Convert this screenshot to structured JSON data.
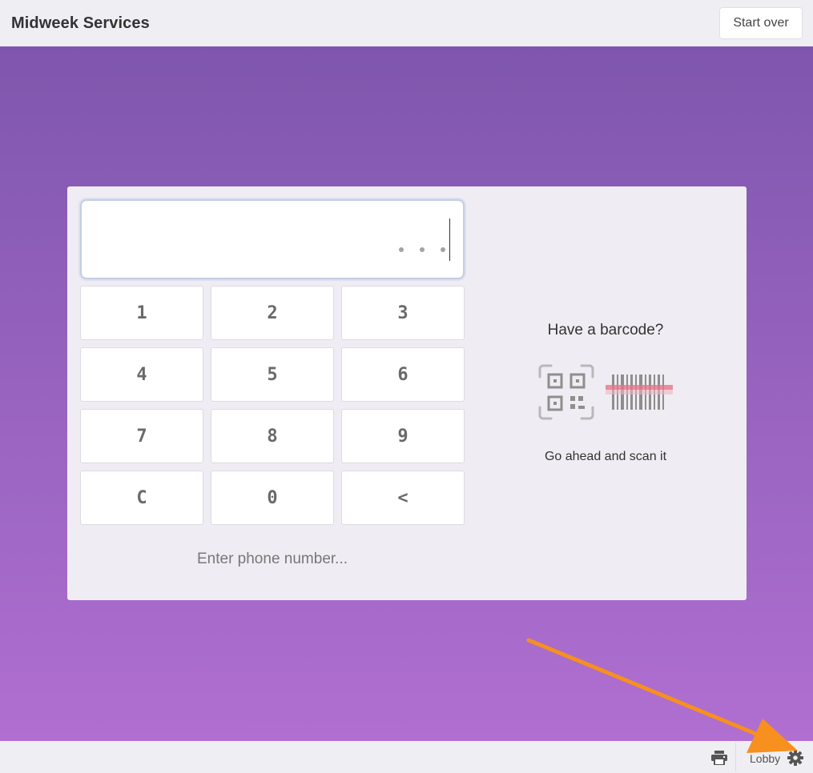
{
  "header": {
    "title": "Midweek Services",
    "start_over_label": "Start over"
  },
  "keypad": {
    "keys": [
      "1",
      "2",
      "3",
      "4",
      "5",
      "6",
      "7",
      "8",
      "9",
      "C",
      "0",
      "<"
    ],
    "hint": "Enter phone number..."
  },
  "barcode": {
    "question": "Have a barcode?",
    "instruction": "Go ahead and scan it",
    "qr_icon": "qr-code-icon",
    "barcode_icon": "barcode-scan-icon"
  },
  "footer": {
    "station_label": "Lobby",
    "print_icon": "printer-icon",
    "settings_icon": "gear-icon"
  },
  "colors": {
    "gradient_top": "#7f56ad",
    "gradient_bottom": "#b06fd1",
    "annotation_arrow": "#f7901e"
  }
}
